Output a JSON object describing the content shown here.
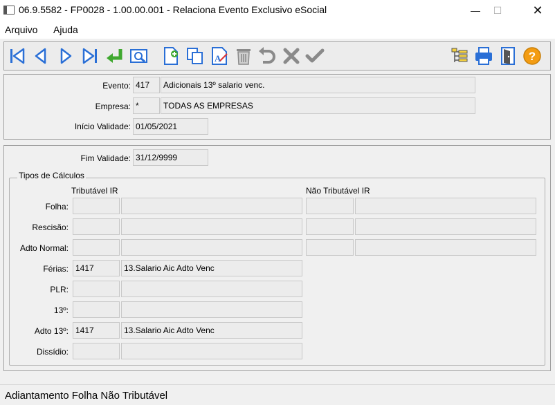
{
  "window": {
    "title": "06.9.5582 - FP0028 - 1.00.00.001 - Relaciona Evento Exclusivo eSocial",
    "minimize": "—",
    "maximize": "☐",
    "close": "✕"
  },
  "menu": {
    "items": [
      "Arquivo",
      "Ajuda"
    ]
  },
  "toolbar": {
    "icons": [
      "first-record-icon",
      "previous-record-icon",
      "next-record-icon",
      "last-record-icon",
      "confirm-arrow-icon",
      "preview-icon",
      "new-record-icon",
      "copy-record-icon",
      "edit-record-icon",
      "delete-record-icon",
      "undo-icon",
      "cancel-icon",
      "save-check-icon",
      "tree-view-icon",
      "print-icon",
      "exit-door-icon",
      "help-icon"
    ],
    "colors": {
      "blue": "#2a6fd6",
      "green": "#3fa82f",
      "gray": "#8a8a8a",
      "orange": "#f39c12"
    }
  },
  "header": {
    "evento_label": "Evento:",
    "evento_code": "417",
    "evento_desc": "Adicionais 13º salario venc.",
    "empresa_label": "Empresa:",
    "empresa_code": "*",
    "empresa_desc": "TODAS AS EMPRESAS",
    "inicio_label": "Início Validade:",
    "inicio_value": "01/05/2021"
  },
  "detail": {
    "fim_label": "Fim Validade:",
    "fim_value": "31/12/9999",
    "group_title": "Tipos de Cálculos",
    "col_tributavel": "Tributável IR",
    "col_nao_tributavel": "Não Tributável IR",
    "rows": [
      {
        "label": "Folha:",
        "trib_code": "",
        "trib_desc": "",
        "nao_code": "",
        "nao_desc": ""
      },
      {
        "label": "Rescisão:",
        "trib_code": "",
        "trib_desc": "",
        "nao_code": "",
        "nao_desc": ""
      },
      {
        "label": "Adto Normal:",
        "trib_code": "",
        "trib_desc": "",
        "nao_code": "",
        "nao_desc": ""
      },
      {
        "label": "Férias:",
        "trib_code": "1417",
        "trib_desc": "13.Salario Aic Adto Venc"
      },
      {
        "label": "PLR:",
        "trib_code": "",
        "trib_desc": ""
      },
      {
        "label": "13º:",
        "trib_code": "",
        "trib_desc": ""
      },
      {
        "label": "Adto 13º:",
        "trib_code": "1417",
        "trib_desc": "13.Salario Aic Adto Venc"
      },
      {
        "label": "Dissídio:",
        "trib_code": "",
        "trib_desc": ""
      }
    ]
  },
  "status": {
    "text": "Adiantamento Folha Não Tributável"
  }
}
